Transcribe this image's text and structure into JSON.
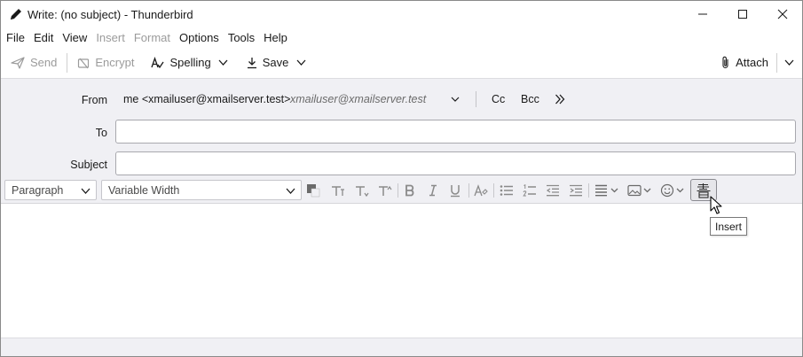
{
  "window": {
    "title": "Write: (no subject) - Thunderbird",
    "controls": [
      "minimize-icon",
      "maximize-icon",
      "close-icon"
    ]
  },
  "menubar": {
    "items": [
      {
        "label": "File",
        "disabled": false
      },
      {
        "label": "Edit",
        "disabled": false
      },
      {
        "label": "View",
        "disabled": false
      },
      {
        "label": "Insert",
        "disabled": true
      },
      {
        "label": "Format",
        "disabled": true
      },
      {
        "label": "Options",
        "disabled": false
      },
      {
        "label": "Tools",
        "disabled": false
      },
      {
        "label": "Help",
        "disabled": false
      }
    ]
  },
  "toolbar": {
    "send_label": "Send",
    "encrypt_label": "Encrypt",
    "spelling_label": "Spelling",
    "save_label": "Save",
    "attach_label": "Attach"
  },
  "header": {
    "from_label": "From",
    "from_value": "me <xmailuser@xmailserver.test>",
    "from_hint": "xmailuser@xmailserver.test",
    "cc_label": "Cc",
    "bcc_label": "Bcc",
    "to_label": "To",
    "to_value": "",
    "subject_label": "Subject",
    "subject_value": ""
  },
  "format_bar": {
    "paragraph_select": "Paragraph",
    "font_select": "Variable Width",
    "icons": [
      "text-color-icon",
      "font-size-smaller-icon",
      "font-size-smaller-2-icon",
      "font-size-larger-icon",
      "bold-icon",
      "italic-icon",
      "underline-icon",
      "remove-formatting-icon",
      "bulleted-list-icon",
      "numbered-list-icon",
      "outdent-icon",
      "indent-icon",
      "align-icon",
      "insert-image-icon",
      "emoji-icon",
      "insert-icon"
    ]
  },
  "tooltip": {
    "text": "Insert"
  },
  "colors": {
    "header_bg": "#f0f0f4",
    "disabled_text": "#9b9b9b"
  }
}
